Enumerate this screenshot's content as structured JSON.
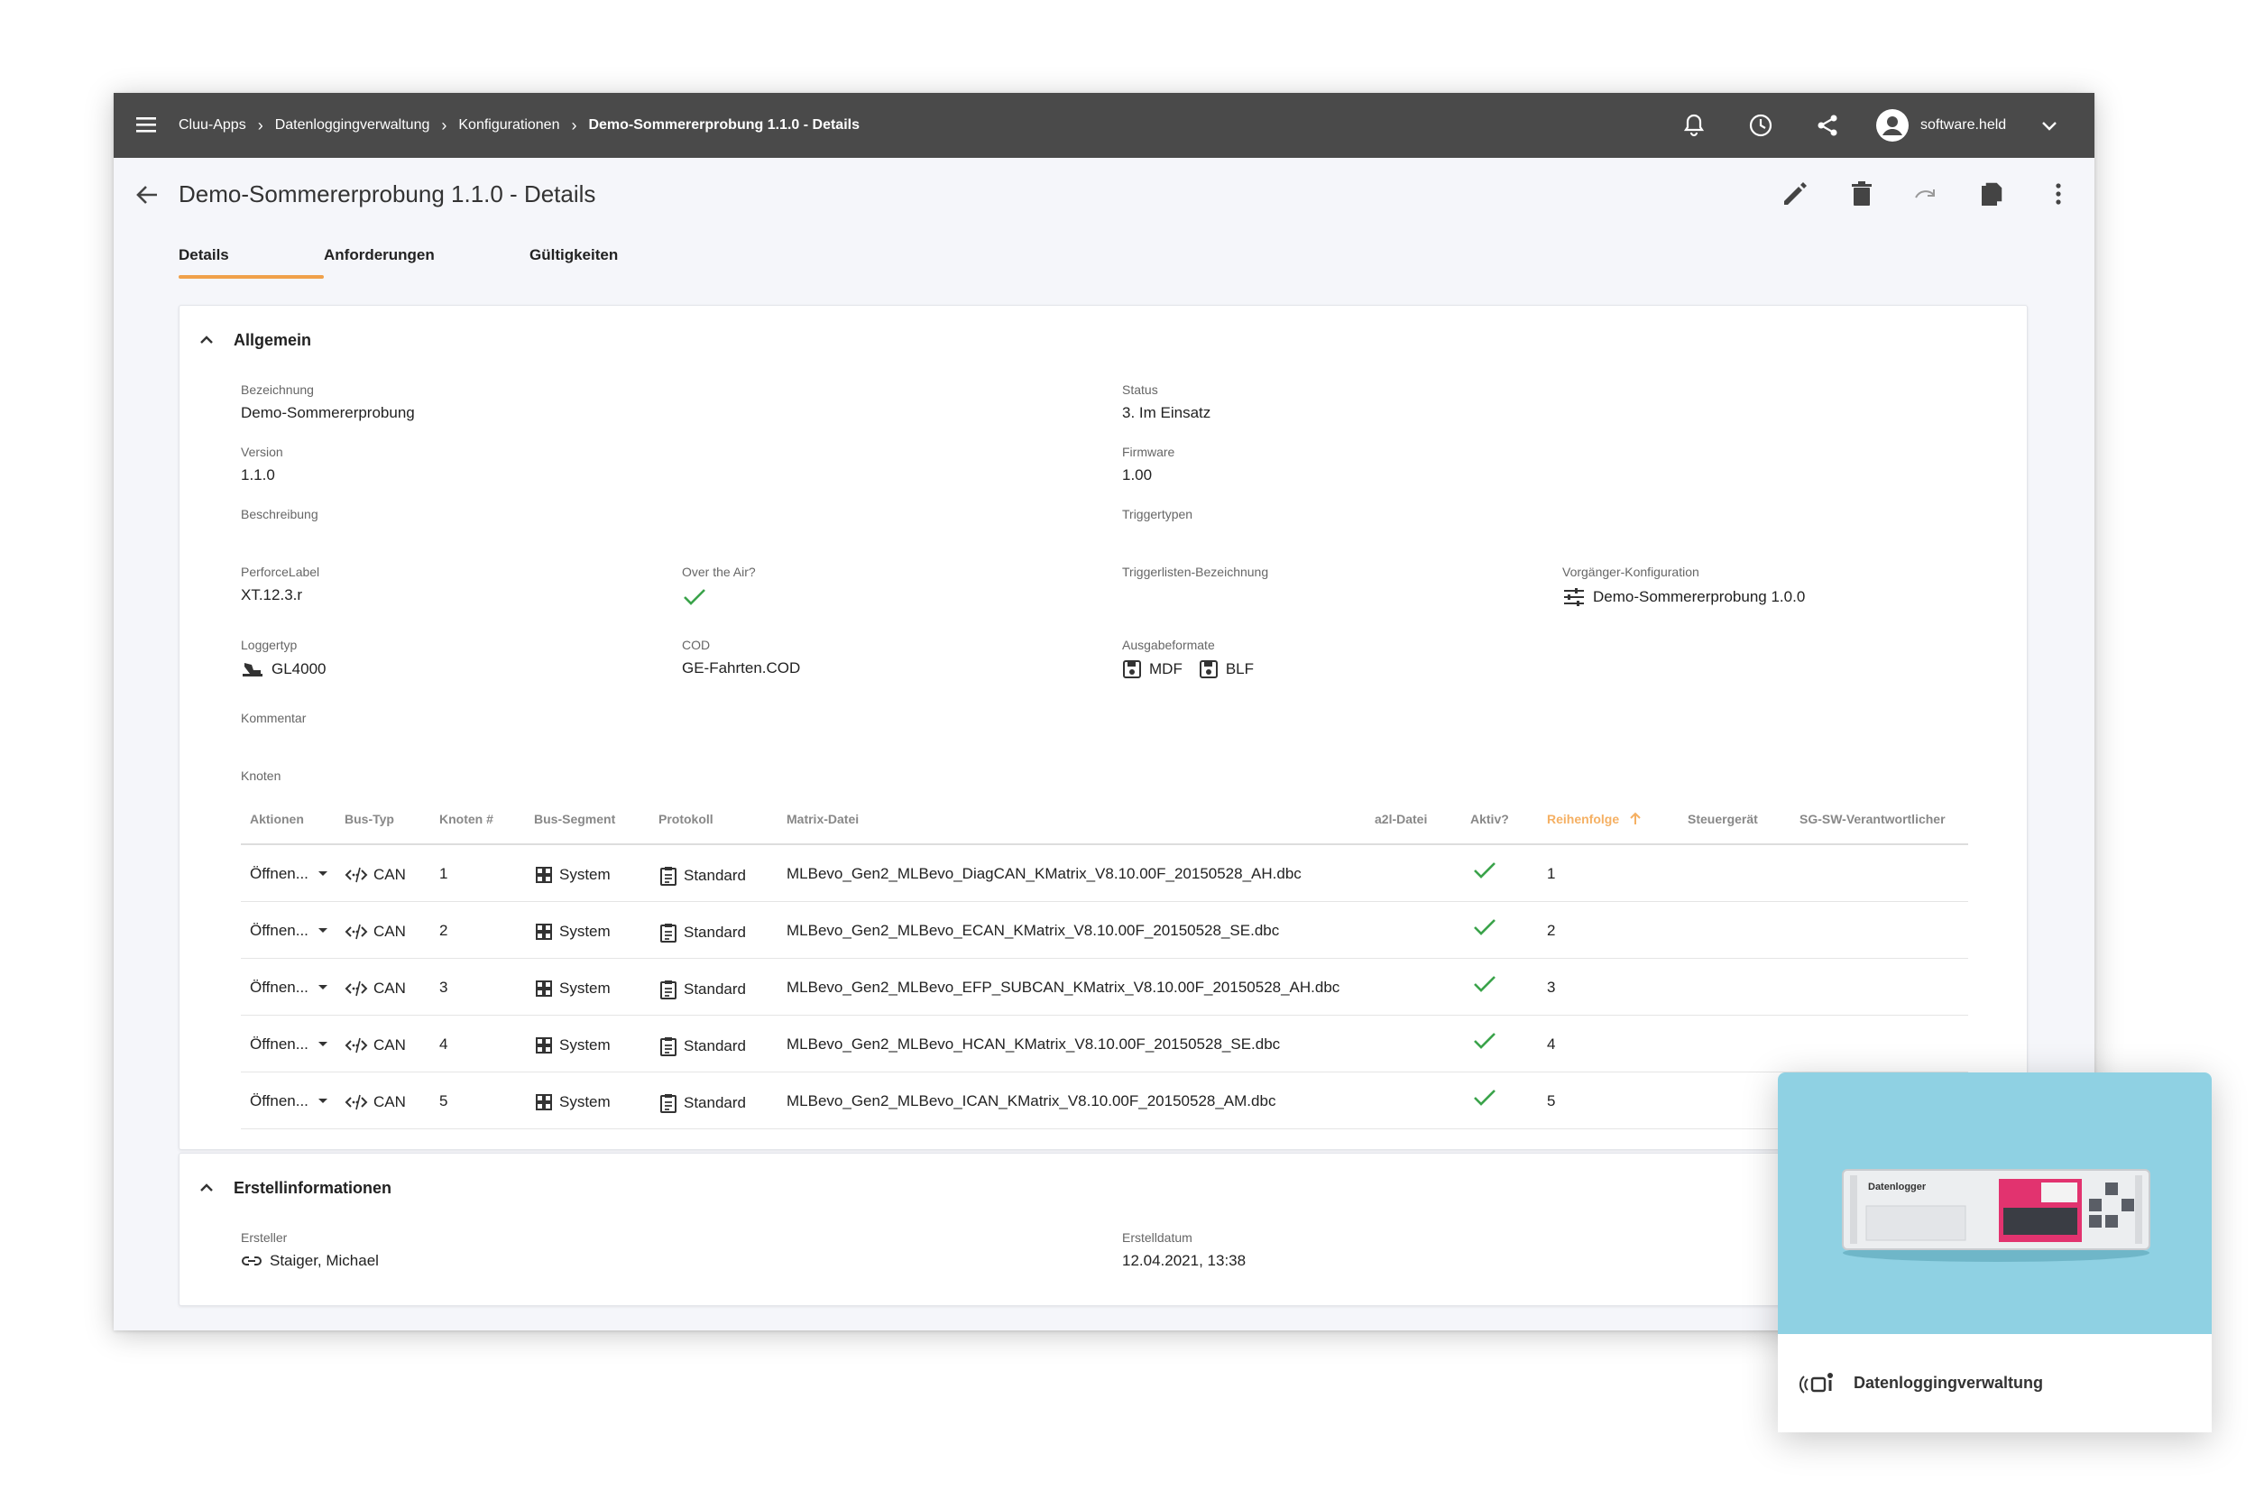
{
  "breadcrumb": [
    "Cluu-Apps",
    "Datenloggingverwaltung",
    "Konfigurationen",
    "Demo-Sommererprobung 1.1.0 - Details"
  ],
  "user": {
    "name": "software.held"
  },
  "page": {
    "title": "Demo-Sommererprobung 1.1.0 - Details"
  },
  "tabs": [
    "Details",
    "Anforderungen",
    "Gültigkeiten"
  ],
  "allgemein": {
    "title": "Allgemein",
    "bezeichnung": {
      "label": "Bezeichnung",
      "value": "Demo-Sommererprobung"
    },
    "status": {
      "label": "Status",
      "value": "3. Im Einsatz"
    },
    "version": {
      "label": "Version",
      "value": "1.1.0"
    },
    "firmware": {
      "label": "Firmware",
      "value": "1.00"
    },
    "beschreibung": {
      "label": "Beschreibung"
    },
    "triggertypen": {
      "label": "Triggertypen"
    },
    "perforce": {
      "label": "PerforceLabel",
      "value": "XT.12.3.r"
    },
    "ota": {
      "label": "Over the Air?",
      "value": true
    },
    "triggerlisten": {
      "label": "Triggerlisten-Bezeichnung"
    },
    "vorgaenger": {
      "label": "Vorgänger-Konfiguration",
      "value": "Demo-Sommererprobung 1.0.0"
    },
    "loggertyp": {
      "label": "Loggertyp",
      "value": "GL4000"
    },
    "cod": {
      "label": "COD",
      "value": "GE-Fahrten.COD"
    },
    "ausgabeformate": {
      "label": "Ausgabeformate",
      "values": [
        "MDF",
        "BLF"
      ]
    },
    "kommentar": {
      "label": "Kommentar"
    },
    "knoten": {
      "label": "Knoten"
    }
  },
  "table": {
    "headers": {
      "aktionen": "Aktionen",
      "bustyp": "Bus-Typ",
      "knoten": "Knoten #",
      "segment": "Bus-Segment",
      "protokoll": "Protokoll",
      "matrix": "Matrix-Datei",
      "a2l": "a2l-Datei",
      "aktiv": "Aktiv?",
      "reihenfolge": "Reihenfolge",
      "steuergeraet": "Steuergerät",
      "sgsw": "SG-SW-Verantwortlicher"
    },
    "rows": [
      {
        "aktion": "Öffnen...",
        "bus": "CAN",
        "nr": "1",
        "segment": "System",
        "protokoll": "Standard",
        "matrix": "MLBevo_Gen2_MLBevo_DiagCAN_KMatrix_V8.10.00F_20150528_AH.dbc",
        "aktiv": true,
        "reihenfolge": "1"
      },
      {
        "aktion": "Öffnen...",
        "bus": "CAN",
        "nr": "2",
        "segment": "System",
        "protokoll": "Standard",
        "matrix": "MLBevo_Gen2_MLBevo_ECAN_KMatrix_V8.10.00F_20150528_SE.dbc",
        "aktiv": true,
        "reihenfolge": "2"
      },
      {
        "aktion": "Öffnen...",
        "bus": "CAN",
        "nr": "3",
        "segment": "System",
        "protokoll": "Standard",
        "matrix": "MLBevo_Gen2_MLBevo_EFP_SUBCAN_KMatrix_V8.10.00F_20150528_AH.dbc",
        "aktiv": true,
        "reihenfolge": "3"
      },
      {
        "aktion": "Öffnen...",
        "bus": "CAN",
        "nr": "4",
        "segment": "System",
        "protokoll": "Standard",
        "matrix": "MLBevo_Gen2_MLBevo_HCAN_KMatrix_V8.10.00F_20150528_SE.dbc",
        "aktiv": true,
        "reihenfolge": "4"
      },
      {
        "aktion": "Öffnen...",
        "bus": "CAN",
        "nr": "5",
        "segment": "System",
        "protokoll": "Standard",
        "matrix": "MLBevo_Gen2_MLBevo_ICAN_KMatrix_V8.10.00F_20150528_AM.dbc",
        "aktiv": true,
        "reihenfolge": "5"
      }
    ]
  },
  "erstell": {
    "title": "Erstellinformationen",
    "ersteller": {
      "label": "Ersteller",
      "value": "Staiger, Michael"
    },
    "datum": {
      "label": "Erstelldatum",
      "value": "12.04.2021, 13:38"
    }
  },
  "overlay": {
    "device_label": "Datenlogger",
    "label": "Datenloggingverwaltung"
  },
  "colors": {
    "topbar": "#4a4a4a",
    "accent": "#f0a14a",
    "check": "#3aa34a",
    "sorted_header": "#f5b063",
    "overlay_bg": "#8fd1e3"
  }
}
